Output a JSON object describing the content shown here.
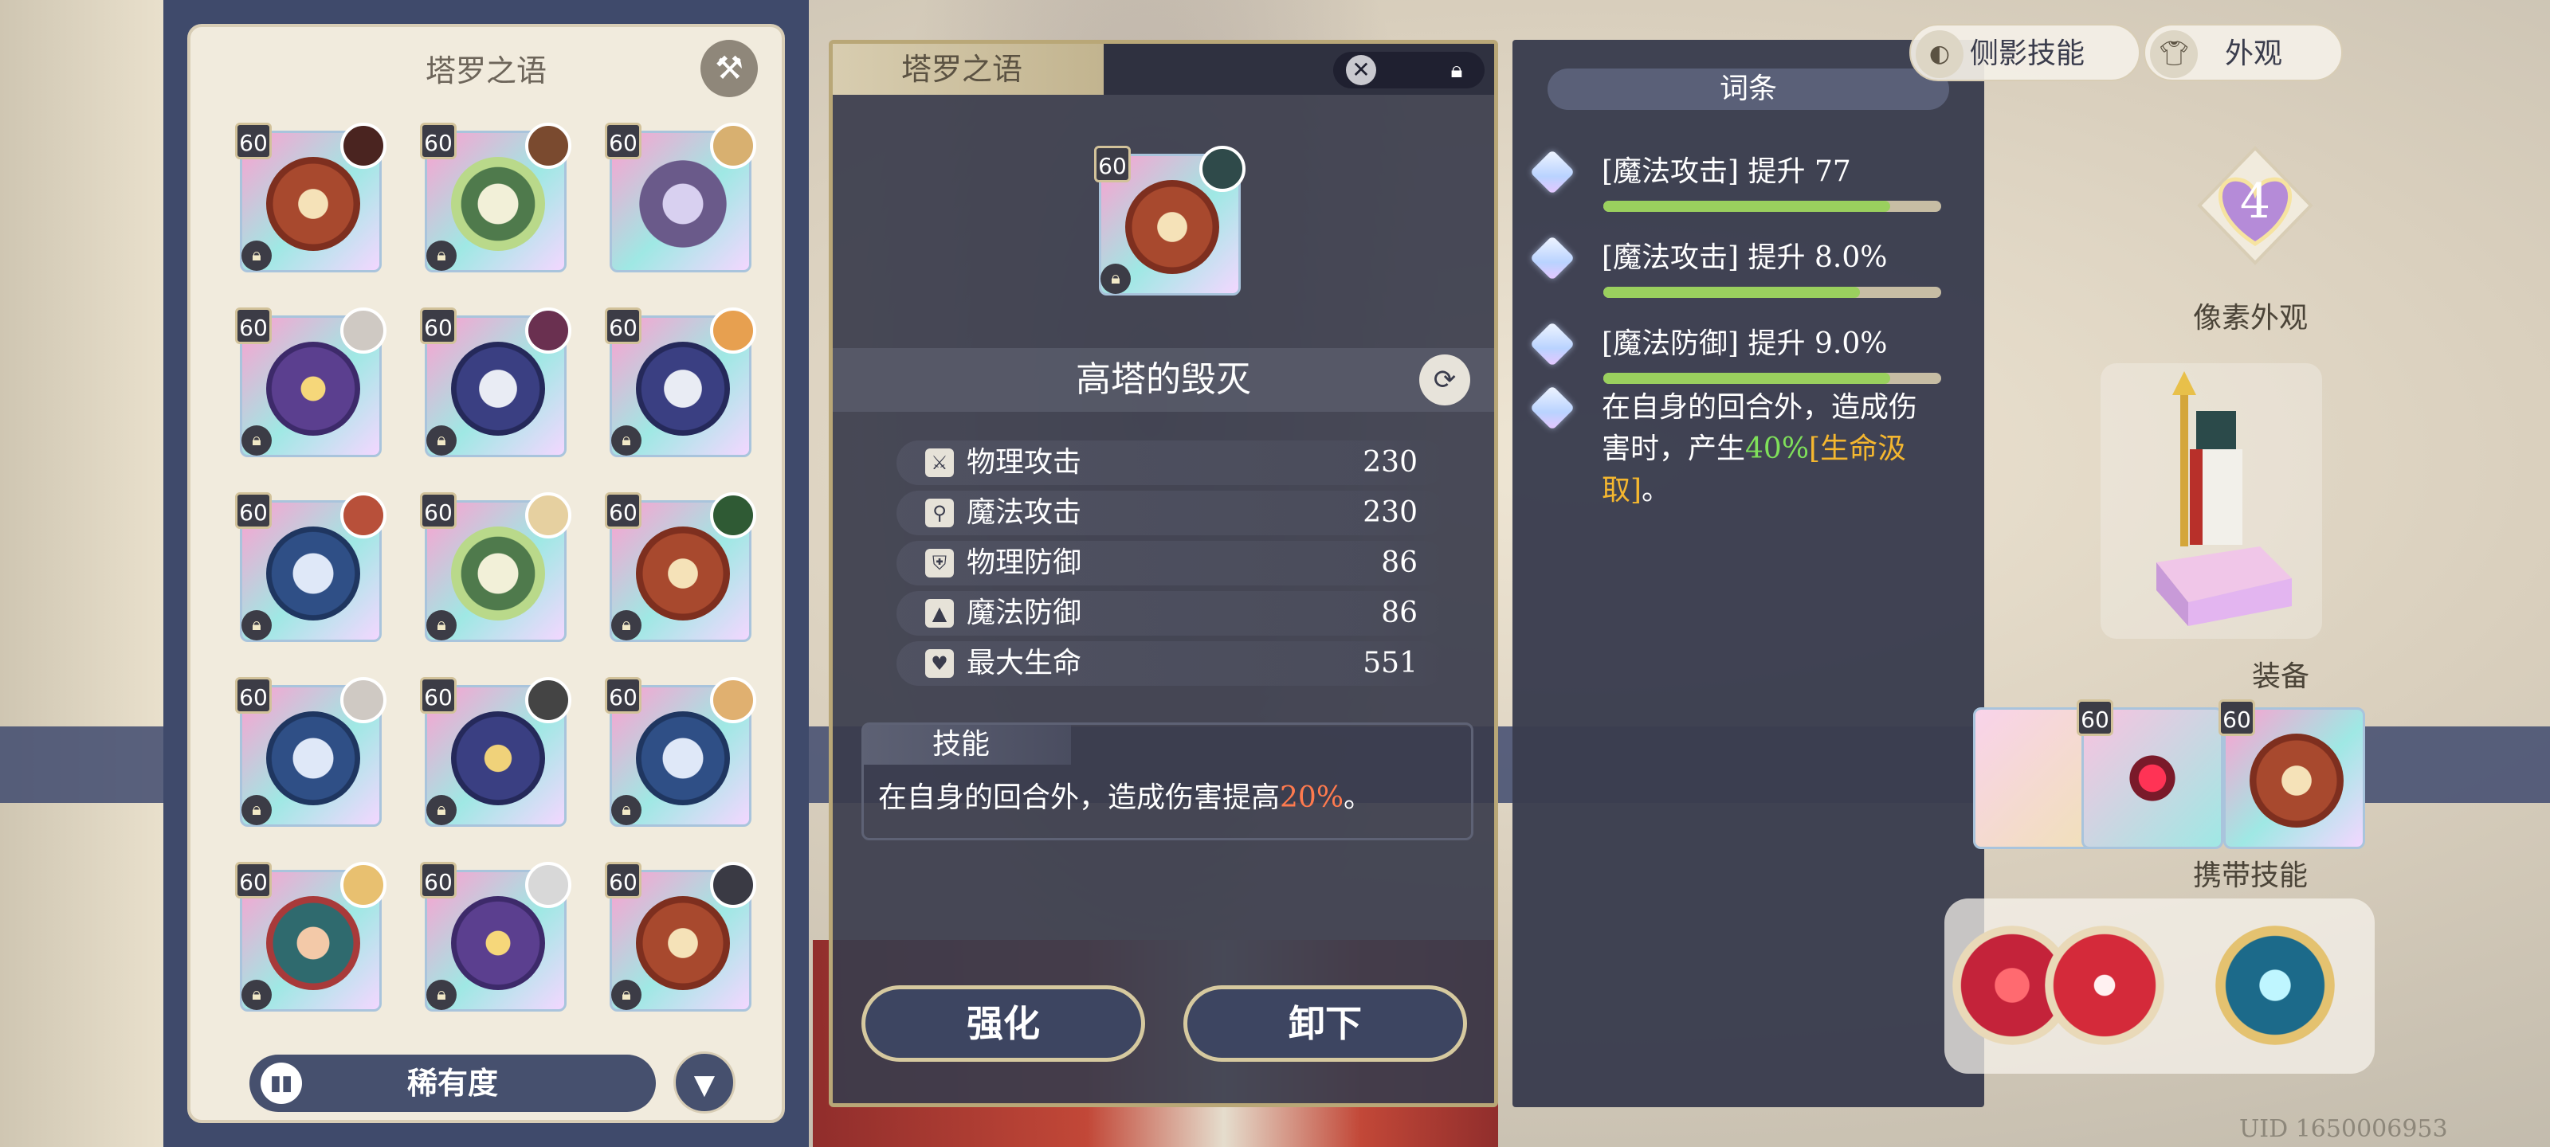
{
  "inventory": {
    "title": "塔罗之语",
    "sort_label": "稀有度",
    "cards": [
      {
        "level": "60",
        "emblem": "tower",
        "emblem_color": "#a8492e",
        "avatar_color": "#4a2420",
        "locked": true
      },
      {
        "level": "60",
        "emblem": "wreath",
        "emblem_color": "#4f7a4c",
        "avatar_color": "#7a4a2f",
        "locked": true
      },
      {
        "level": "60",
        "emblem": "devil",
        "emblem_color": "#6a5a8a",
        "avatar_color": "#d8b070",
        "locked": false
      },
      {
        "level": "60",
        "emblem": "moon",
        "emblem_color": "#5b3f8f",
        "avatar_color": "#cfc9c3",
        "locked": true
      },
      {
        "level": "60",
        "emblem": "horse",
        "emblem_color": "#3a3f82",
        "avatar_color": "#6a3050",
        "locked": true
      },
      {
        "level": "60",
        "emblem": "horse",
        "emblem_color": "#3a3f82",
        "avatar_color": "#e7a050",
        "locked": true
      },
      {
        "level": "60",
        "emblem": "scroll",
        "emblem_color": "#2f4f86",
        "avatar_color": "#b8503a",
        "locked": true
      },
      {
        "level": "60",
        "emblem": "wreath",
        "emblem_color": "#4f7a4c",
        "avatar_color": "#e6d0a0",
        "locked": true
      },
      {
        "level": "60",
        "emblem": "tower",
        "emblem_color": "#a8492e",
        "avatar_color": "#2f5a34",
        "locked": true
      },
      {
        "level": "60",
        "emblem": "scroll",
        "emblem_color": "#2f4f86",
        "avatar_color": "#cfc9c3",
        "locked": true
      },
      {
        "level": "60",
        "emblem": "scales",
        "emblem_color": "#3a3f82",
        "avatar_color": "#444444",
        "locked": true
      },
      {
        "level": "60",
        "emblem": "scroll",
        "emblem_color": "#2f4f86",
        "avatar_color": "#e0b070",
        "locked": true
      },
      {
        "level": "60",
        "emblem": "lady",
        "emblem_color": "#2f6a6e",
        "avatar_color": "#e8c070",
        "locked": true
      },
      {
        "level": "60",
        "emblem": "moon",
        "emblem_color": "#5b3f8f",
        "avatar_color": "#d8d8d8",
        "locked": true
      },
      {
        "level": "60",
        "emblem": "tower",
        "emblem_color": "#a8492e",
        "avatar_color": "#3a3a44",
        "locked": true
      }
    ]
  },
  "detail": {
    "tab_title": "塔罗之语",
    "card_level": "60",
    "card_name": "高塔的毁灭",
    "stats": [
      {
        "icon": "sword-icon",
        "glyph": "⚔",
        "name": "物理攻击",
        "value": "230"
      },
      {
        "icon": "wand-icon",
        "glyph": "⚲",
        "name": "魔法攻击",
        "value": "230"
      },
      {
        "icon": "shield-icon",
        "glyph": "⛨",
        "name": "物理防御",
        "value": "86"
      },
      {
        "icon": "wizard-hat-icon",
        "glyph": "▲",
        "name": "魔法防御",
        "value": "86"
      },
      {
        "icon": "heart-icon",
        "glyph": "♥",
        "name": "最大生命",
        "value": "551"
      }
    ],
    "skill_title": "技能",
    "skill_desc_a": "在自身的回合外，造成伤害提高",
    "skill_desc_pct": "20%",
    "skill_desc_b": "。",
    "enhance_label": "强化",
    "unequip_label": "卸下"
  },
  "affixes": {
    "header": "词条",
    "items": [
      {
        "text": "[魔法攻击] 提升 77",
        "fill": 0.85
      },
      {
        "text": "[魔法攻击] 提升 8.0%",
        "fill": 0.76
      },
      {
        "text": "[魔法防御] 提升 9.0%",
        "fill": 0.85
      }
    ],
    "special_a": "在自身的回合外，造成伤害时，产生",
    "special_pct": "40%",
    "special_tag": "[生命汲取]",
    "special_b": "。"
  },
  "sidebar": {
    "tabs": [
      {
        "label": "侧影技能",
        "icon": "silhouette-icon"
      },
      {
        "label": "外观",
        "icon": "shirt-icon"
      }
    ],
    "heart_level": "4",
    "pixel_label": "像素外观",
    "equip_label": "装备",
    "equip_levels": [
      "60",
      "60"
    ],
    "carry_skill_label": "携带技能",
    "uid": "UID 1650006953"
  }
}
